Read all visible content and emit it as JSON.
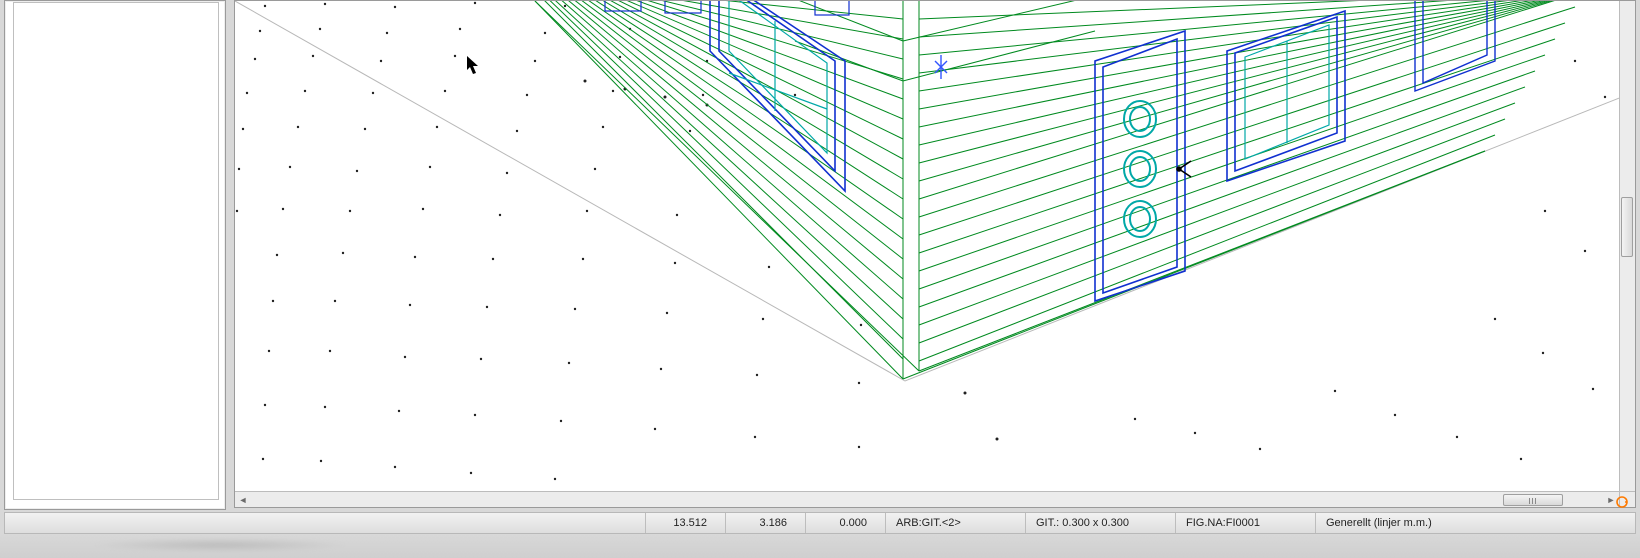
{
  "status": {
    "x": "13.512",
    "y": "3.186",
    "z": "0.000",
    "arb": "ARB:GIT.<2>",
    "git": "GIT.: 0.300 x 0.300",
    "figna": "FIG.NA:FI0001",
    "mode": "Generellt (linjer m.m.)"
  },
  "colors": {
    "wall_edge": "#008a1f",
    "feature_edge": "#1030d0",
    "feature_inner": "#00a8a8",
    "grid_dot": "#202020",
    "origin": "#3355ff",
    "handle": "#ff7a00"
  }
}
